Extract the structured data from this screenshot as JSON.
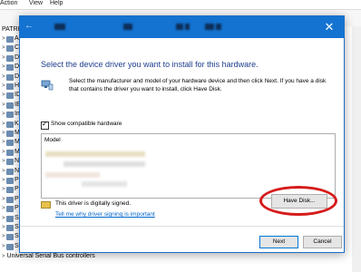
{
  "background": {
    "menu": [
      "Action",
      "View",
      "Help"
    ],
    "tree_root": "PATRIC",
    "tree_items": [
      {
        "expander": ">",
        "label": "Au"
      },
      {
        "expander": ">",
        "label": "Co"
      },
      {
        "expander": ">",
        "label": "Dis"
      },
      {
        "expander": ">",
        "label": "Dis"
      },
      {
        "expander": ">",
        "label": "DV"
      },
      {
        "expander": ">",
        "label": "Hu"
      },
      {
        "expander": ">",
        "label": "IDI"
      },
      {
        "expander": ">",
        "label": "IEE"
      },
      {
        "expander": ">",
        "label": "Im"
      },
      {
        "expander": ">",
        "label": "Ke"
      },
      {
        "expander": ">",
        "label": "Mi"
      },
      {
        "expander": ">",
        "label": "Mo"
      },
      {
        "expander": ">",
        "label": "Mo"
      },
      {
        "expander": ">",
        "label": "Ne"
      },
      {
        "expander": ">",
        "label": "Ne"
      },
      {
        "expander": ">",
        "label": "Po"
      },
      {
        "expander": ">",
        "label": "Pri"
      },
      {
        "expander": ">",
        "label": "Pri"
      },
      {
        "expander": ">",
        "label": "Pro"
      },
      {
        "expander": ">",
        "label": "So"
      },
      {
        "expander": ">",
        "label": "So"
      },
      {
        "expander": ">",
        "label": "Sto"
      },
      {
        "expander": ">",
        "label": "Sys"
      }
    ],
    "tree_last": "Universal Serial Bus controllers"
  },
  "dialog": {
    "heading": "Select the device driver you want to install for this hardware.",
    "instructions": "Select the manufacturer and model of your hardware device and then click Next. If you have a disk that contains the driver you want to install, click Have Disk.",
    "show_compatible_label": "Show compatible hardware",
    "show_compatible_checked": true,
    "list_header": "Model",
    "signed_text": "This driver is digitally signed.",
    "signing_link": "Tell me why driver signing is important",
    "have_disk_label": "Have Disk...",
    "next_label": "Next",
    "cancel_label": "Cancel",
    "close_glyph": "✕",
    "back_glyph": "←"
  },
  "colors": {
    "titlebar": "#1473d1",
    "heading": "#1e3e8c",
    "link": "#0066cc",
    "highlight_ellipse": "#d61b1b"
  },
  "icons": [
    "back-arrow-icon",
    "close-icon",
    "hardware-icon",
    "signed-driver-icon"
  ]
}
